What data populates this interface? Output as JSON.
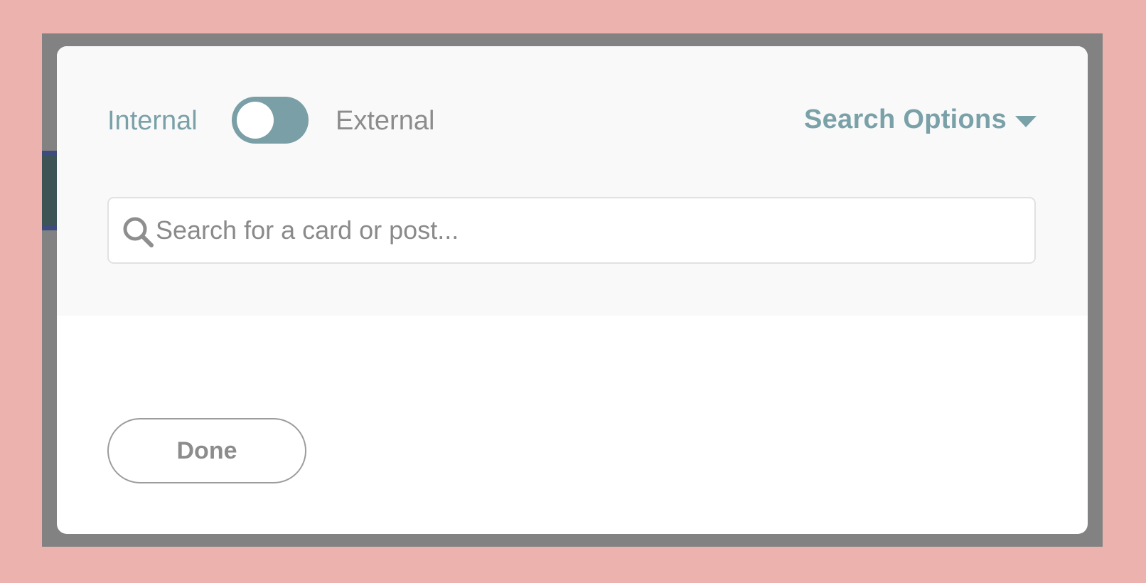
{
  "scope_toggle": {
    "left_label": "Internal",
    "right_label": "External"
  },
  "search_options": {
    "label": "Search Options",
    "icon": "chevron-down-icon"
  },
  "search": {
    "value": "",
    "placeholder": "Search for a card or post...",
    "icon": "search-icon"
  },
  "footer": {
    "done_label": "Done"
  },
  "colors": {
    "accent": "#7aa1a8",
    "toggle_track": "#7a9fa6",
    "muted_text": "#8c8c8c",
    "overlay_background": "#ecb3ae"
  }
}
